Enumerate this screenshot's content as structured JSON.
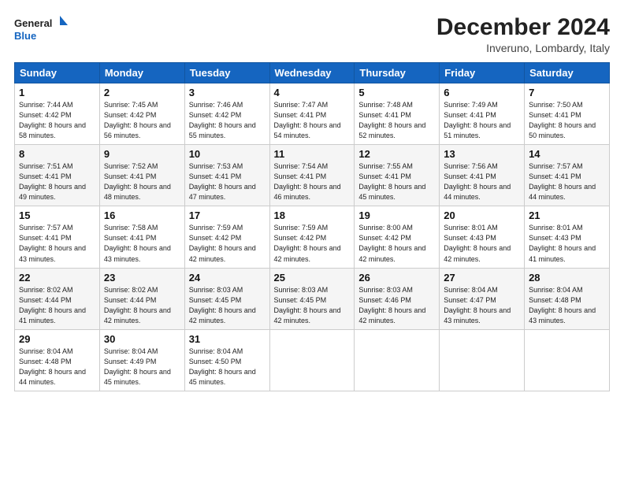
{
  "logo": {
    "line1": "General",
    "line2": "Blue"
  },
  "title": "December 2024",
  "location": "Inveruno, Lombardy, Italy",
  "days_of_week": [
    "Sunday",
    "Monday",
    "Tuesday",
    "Wednesday",
    "Thursday",
    "Friday",
    "Saturday"
  ],
  "weeks": [
    [
      {
        "num": "1",
        "sunrise": "7:44 AM",
        "sunset": "4:42 PM",
        "daylight": "8 hours and 58 minutes."
      },
      {
        "num": "2",
        "sunrise": "7:45 AM",
        "sunset": "4:42 PM",
        "daylight": "8 hours and 56 minutes."
      },
      {
        "num": "3",
        "sunrise": "7:46 AM",
        "sunset": "4:42 PM",
        "daylight": "8 hours and 55 minutes."
      },
      {
        "num": "4",
        "sunrise": "7:47 AM",
        "sunset": "4:41 PM",
        "daylight": "8 hours and 54 minutes."
      },
      {
        "num": "5",
        "sunrise": "7:48 AM",
        "sunset": "4:41 PM",
        "daylight": "8 hours and 52 minutes."
      },
      {
        "num": "6",
        "sunrise": "7:49 AM",
        "sunset": "4:41 PM",
        "daylight": "8 hours and 51 minutes."
      },
      {
        "num": "7",
        "sunrise": "7:50 AM",
        "sunset": "4:41 PM",
        "daylight": "8 hours and 50 minutes."
      }
    ],
    [
      {
        "num": "8",
        "sunrise": "7:51 AM",
        "sunset": "4:41 PM",
        "daylight": "8 hours and 49 minutes."
      },
      {
        "num": "9",
        "sunrise": "7:52 AM",
        "sunset": "4:41 PM",
        "daylight": "8 hours and 48 minutes."
      },
      {
        "num": "10",
        "sunrise": "7:53 AM",
        "sunset": "4:41 PM",
        "daylight": "8 hours and 47 minutes."
      },
      {
        "num": "11",
        "sunrise": "7:54 AM",
        "sunset": "4:41 PM",
        "daylight": "8 hours and 46 minutes."
      },
      {
        "num": "12",
        "sunrise": "7:55 AM",
        "sunset": "4:41 PM",
        "daylight": "8 hours and 45 minutes."
      },
      {
        "num": "13",
        "sunrise": "7:56 AM",
        "sunset": "4:41 PM",
        "daylight": "8 hours and 44 minutes."
      },
      {
        "num": "14",
        "sunrise": "7:57 AM",
        "sunset": "4:41 PM",
        "daylight": "8 hours and 44 minutes."
      }
    ],
    [
      {
        "num": "15",
        "sunrise": "7:57 AM",
        "sunset": "4:41 PM",
        "daylight": "8 hours and 43 minutes."
      },
      {
        "num": "16",
        "sunrise": "7:58 AM",
        "sunset": "4:41 PM",
        "daylight": "8 hours and 43 minutes."
      },
      {
        "num": "17",
        "sunrise": "7:59 AM",
        "sunset": "4:42 PM",
        "daylight": "8 hours and 42 minutes."
      },
      {
        "num": "18",
        "sunrise": "7:59 AM",
        "sunset": "4:42 PM",
        "daylight": "8 hours and 42 minutes."
      },
      {
        "num": "19",
        "sunrise": "8:00 AM",
        "sunset": "4:42 PM",
        "daylight": "8 hours and 42 minutes."
      },
      {
        "num": "20",
        "sunrise": "8:01 AM",
        "sunset": "4:43 PM",
        "daylight": "8 hours and 42 minutes."
      },
      {
        "num": "21",
        "sunrise": "8:01 AM",
        "sunset": "4:43 PM",
        "daylight": "8 hours and 41 minutes."
      }
    ],
    [
      {
        "num": "22",
        "sunrise": "8:02 AM",
        "sunset": "4:44 PM",
        "daylight": "8 hours and 41 minutes."
      },
      {
        "num": "23",
        "sunrise": "8:02 AM",
        "sunset": "4:44 PM",
        "daylight": "8 hours and 42 minutes."
      },
      {
        "num": "24",
        "sunrise": "8:03 AM",
        "sunset": "4:45 PM",
        "daylight": "8 hours and 42 minutes."
      },
      {
        "num": "25",
        "sunrise": "8:03 AM",
        "sunset": "4:45 PM",
        "daylight": "8 hours and 42 minutes."
      },
      {
        "num": "26",
        "sunrise": "8:03 AM",
        "sunset": "4:46 PM",
        "daylight": "8 hours and 42 minutes."
      },
      {
        "num": "27",
        "sunrise": "8:04 AM",
        "sunset": "4:47 PM",
        "daylight": "8 hours and 43 minutes."
      },
      {
        "num": "28",
        "sunrise": "8:04 AM",
        "sunset": "4:48 PM",
        "daylight": "8 hours and 43 minutes."
      }
    ],
    [
      {
        "num": "29",
        "sunrise": "8:04 AM",
        "sunset": "4:48 PM",
        "daylight": "8 hours and 44 minutes."
      },
      {
        "num": "30",
        "sunrise": "8:04 AM",
        "sunset": "4:49 PM",
        "daylight": "8 hours and 45 minutes."
      },
      {
        "num": "31",
        "sunrise": "8:04 AM",
        "sunset": "4:50 PM",
        "daylight": "8 hours and 45 minutes."
      },
      null,
      null,
      null,
      null
    ]
  ]
}
